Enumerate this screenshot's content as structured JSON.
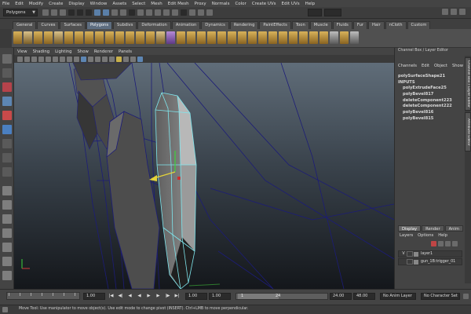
{
  "menubar": {
    "items": [
      "File",
      "Edit",
      "Modify",
      "Create",
      "Display",
      "Window",
      "Assets",
      "Select",
      "Mesh",
      "Edit Mesh",
      "Proxy",
      "Normals",
      "Color",
      "Create UVs",
      "Edit UVs",
      "Help"
    ]
  },
  "statusline": {
    "mode": "Polygons"
  },
  "shelf": {
    "tabs": [
      "General",
      "Curves",
      "Surfaces",
      "Polygons",
      "Subdivs",
      "Deformation",
      "Animation",
      "Dynamics",
      "Rendering",
      "PaintEffects",
      "Toon",
      "Muscle",
      "Fluids",
      "Fur",
      "Hair",
      "nCloth",
      "Custom"
    ],
    "active": "Polygons"
  },
  "panel": {
    "menus": [
      "View",
      "Shading",
      "Lighting",
      "Show",
      "Renderer",
      "Panels"
    ]
  },
  "channel_box": {
    "title": "Channel Box / Layer Editor",
    "menus": [
      "Channels",
      "Edit",
      "Object",
      "Show"
    ],
    "lines": [
      "polySurfaceShape21",
      "INPUTS",
      "polyExtrudeFace25",
      "polyBevel817",
      "deleteComponent223",
      "deleteComponent222",
      "polyBevel816",
      "polyBevel815"
    ]
  },
  "side_tabs": [
    "Channel Box / Layer Editor",
    "Attribute Editor"
  ],
  "layer_editor": {
    "tabs": [
      "Display",
      "Render",
      "Anim"
    ],
    "active": "Display",
    "menus": [
      "Layers",
      "Options",
      "Help"
    ],
    "layers": [
      {
        "v": "V",
        "name": "layer1"
      },
      {
        "v": "",
        "name": "gun_1B:trigger_01"
      }
    ]
  },
  "timeline": {
    "start_field": "1.00",
    "current_field": "1.00",
    "range_start_field": "1.00",
    "range_start2": "1.00",
    "range_handle_start": "1",
    "range_handle_end": "24",
    "range_end_field": "24.00",
    "anim_end_field": "48.00",
    "anim_layer": "No Anim Layer",
    "char_set": "No Character Set",
    "ticks": [
      "1",
      "",
      "",
      "",
      "",
      "",
      "",
      "",
      "",
      "",
      "",
      "",
      "",
      "",
      "",
      "",
      "",
      "",
      "",
      "",
      "",
      "",
      "",
      "24"
    ]
  },
  "helpline": {
    "text": "Move Tool: Use manipulator to move object(s). Use edit mode to change pivot (INSERT). Ctrl+LMB to move perpendicular."
  },
  "colors": {
    "selection_cyan": "#7fe7ee",
    "wireframe_blue": "#1c1c78",
    "viewport_top": "#606d79",
    "viewport_bottom": "#14171b"
  }
}
